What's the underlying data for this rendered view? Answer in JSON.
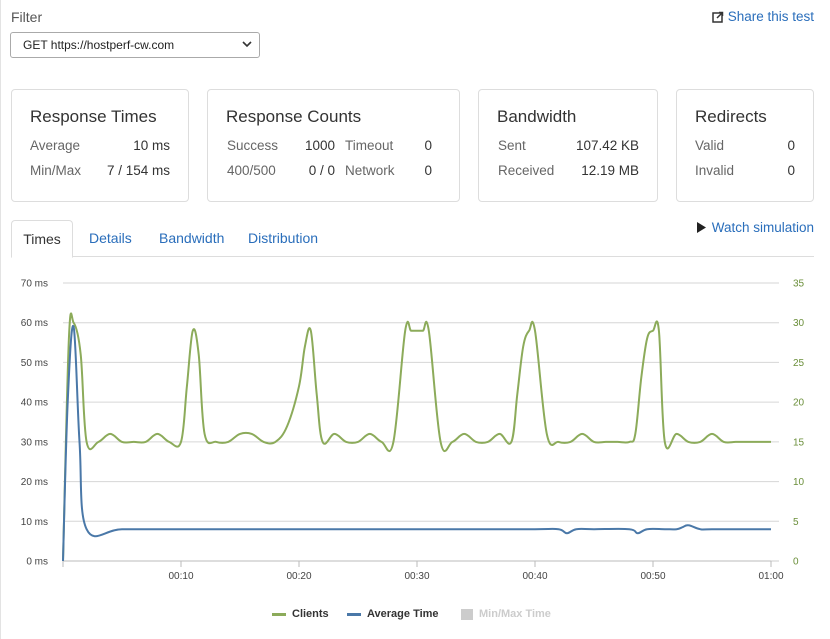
{
  "filter": {
    "label": "Filter",
    "selected": "GET https://hostperf-cw.com"
  },
  "share_label": "Share this test",
  "cards": {
    "response_times": {
      "title": "Response Times",
      "average_label": "Average",
      "average": "10 ms",
      "minmax_label": "Min/Max",
      "minmax": "7 / 154 ms"
    },
    "response_counts": {
      "title": "Response Counts",
      "success_label": "Success",
      "success": "1000",
      "timeout_label": "Timeout",
      "timeout": "0",
      "err_label": "400/500",
      "err": "0 / 0",
      "network_label": "Network",
      "network": "0"
    },
    "bandwidth": {
      "title": "Bandwidth",
      "sent_label": "Sent",
      "sent": "107.42 KB",
      "received_label": "Received",
      "received": "12.19 MB"
    },
    "redirects": {
      "title": "Redirects",
      "valid_label": "Valid",
      "valid": "0",
      "invalid_label": "Invalid",
      "invalid": "0"
    }
  },
  "tabs": [
    "Times",
    "Details",
    "Bandwidth",
    "Distribution"
  ],
  "watch_label": "Watch simulation",
  "colors": {
    "clients": "#8cab5a",
    "average": "#4a78a8",
    "minmax": "#cccccc",
    "link": "#2a6ebb"
  },
  "chart_data": {
    "type": "line",
    "x_ticks": [
      "00:10",
      "00:20",
      "00:30",
      "00:40",
      "00:50",
      "01:00"
    ],
    "y_left_ticks": [
      "0 ms",
      "10 ms",
      "20 ms",
      "30 ms",
      "40 ms",
      "50 ms",
      "60 ms",
      "70 ms"
    ],
    "y_right_ticks": [
      "0",
      "5",
      "10",
      "15",
      "20",
      "25",
      "30",
      "35"
    ],
    "y_left_range": [
      0,
      70
    ],
    "y_right_range": [
      0,
      35
    ],
    "x_range_seconds": [
      0,
      60
    ],
    "grid": true,
    "legend_position": "bottom-center",
    "series": [
      {
        "name": "Clients",
        "axis": "right",
        "x": [
          0,
          0.5,
          0.9,
          1.5,
          2,
          3,
          4,
          5,
          6,
          7,
          8,
          9,
          10,
          10.5,
          11,
          11.5,
          12,
          13,
          14,
          15,
          16,
          17,
          18,
          19,
          20,
          20.5,
          21,
          21.5,
          22,
          23,
          24,
          25,
          26,
          27,
          28,
          29,
          29.5,
          30,
          30.5,
          31,
          32,
          33,
          34,
          35,
          36,
          37,
          38,
          38.5,
          39,
          39.5,
          40,
          41,
          42,
          43,
          44,
          45,
          46,
          47,
          48,
          48.5,
          49,
          49.5,
          50,
          50.5,
          51,
          52,
          53,
          54,
          55,
          56,
          57,
          58,
          59,
          60
        ],
        "values": [
          0,
          28,
          30,
          26,
          15,
          15,
          16,
          15,
          15,
          15,
          16,
          15,
          15,
          22,
          29,
          26,
          16,
          15,
          15,
          16,
          16,
          15,
          15,
          17,
          22,
          27,
          29,
          21,
          15,
          16,
          15,
          15,
          16,
          15,
          15,
          29,
          29,
          29,
          29,
          29,
          15,
          15,
          16,
          15,
          15,
          16,
          15,
          21,
          27,
          29,
          29,
          16,
          15,
          15,
          16,
          15,
          15,
          15,
          15,
          16,
          23,
          28,
          29,
          29,
          15,
          16,
          15,
          15,
          16,
          15,
          15,
          15,
          15,
          15
        ]
      },
      {
        "name": "Average Time",
        "axis": "left",
        "x": [
          0,
          0.4,
          0.9,
          1.4,
          2,
          5,
          10,
          15,
          20,
          25,
          30,
          35,
          40,
          42,
          42.7,
          43.5,
          45,
          48,
          48.7,
          49.5,
          51,
          52,
          52.5,
          53,
          54,
          55,
          60
        ],
        "values": [
          0,
          40,
          59,
          30,
          8,
          8,
          8,
          8,
          8,
          8,
          8,
          8,
          8,
          8,
          7,
          8,
          8,
          8,
          7,
          8,
          8,
          8,
          8.5,
          9,
          8,
          8,
          8
        ]
      },
      {
        "name": "Min/Max Time",
        "axis": "left",
        "hidden": true,
        "x": [],
        "values": []
      }
    ]
  }
}
